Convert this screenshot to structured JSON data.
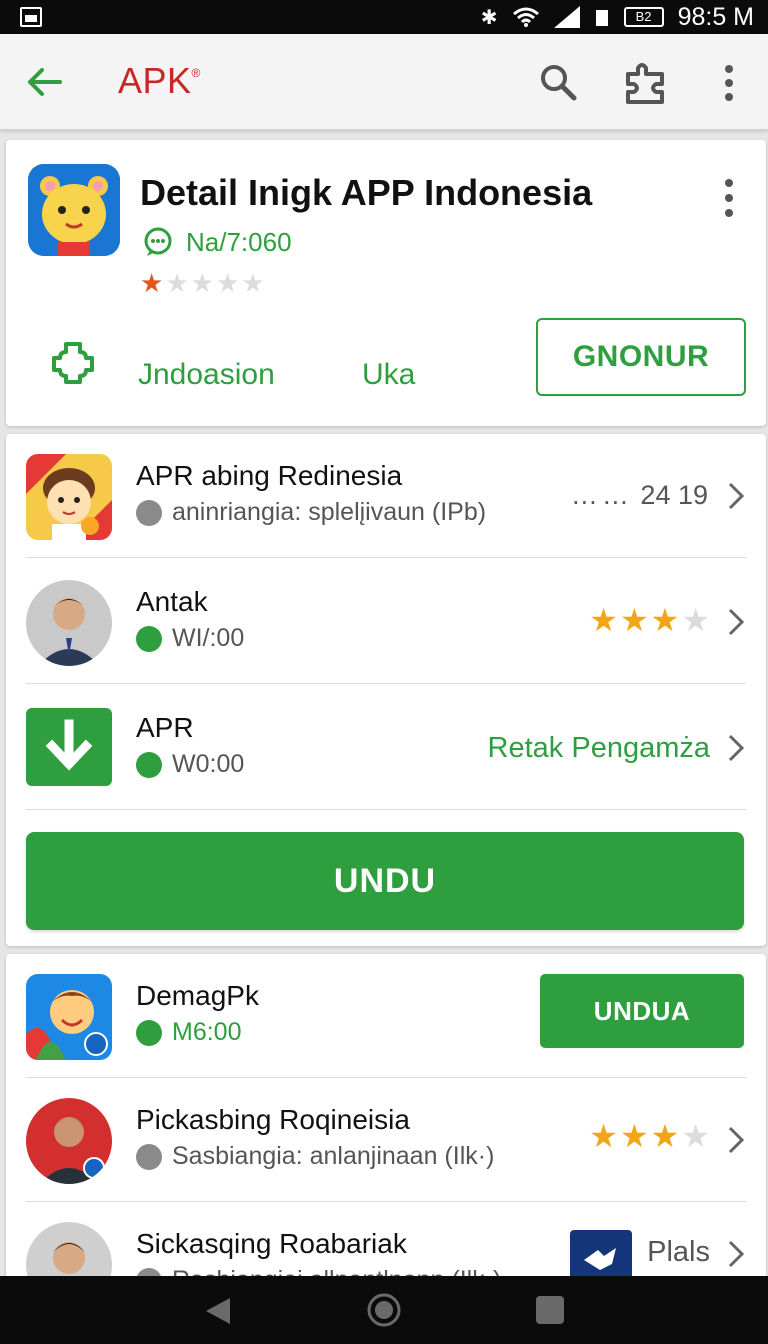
{
  "status_bar": {
    "time": "98:5 M",
    "battery_label": "B2"
  },
  "app_bar": {
    "title": "APK",
    "title_mark": "®"
  },
  "detail": {
    "title": "Detail Inigk APP Indonesia",
    "meta": "Na/7:060",
    "rating": 1,
    "rating_max": 5,
    "tab_1": "Jndoasion",
    "tab_2": "Uka",
    "button": "GNONUR"
  },
  "list": {
    "row_1": {
      "title": "APR abing Redinesia",
      "subtitle": "aninriangia: splelįivaun (IPb)",
      "trailing": "24 19"
    },
    "row_2": {
      "title": "Antak",
      "subtitle": "WI/:00",
      "rating": 2.5,
      "rating_max": 5
    },
    "row_3": {
      "title": "APR",
      "subtitle": "W0:00",
      "trailing": "Retak Pengamża"
    },
    "button": "UNDU"
  },
  "list2": {
    "row_1": {
      "title": "DemagPk",
      "subtitle": "M6:00",
      "button": "UNDUA"
    },
    "row_2": {
      "title": "Pickasbing Roqineisia",
      "subtitle": "Sasbiangia: anlanjinaan (Ilk·)",
      "rating": 3,
      "rating_max": 5
    },
    "row_3": {
      "title": "Sickasqing Roabariak",
      "subtitle": "Rasbiangiei allnantlnann (Ilk·)",
      "trailing": "Plals"
    }
  },
  "colors": {
    "green": "#2e9e3e",
    "red_title": "#c62828",
    "star": "#f2a516",
    "star_empty": "#dcdcdc",
    "star_red": "#e4571c"
  }
}
